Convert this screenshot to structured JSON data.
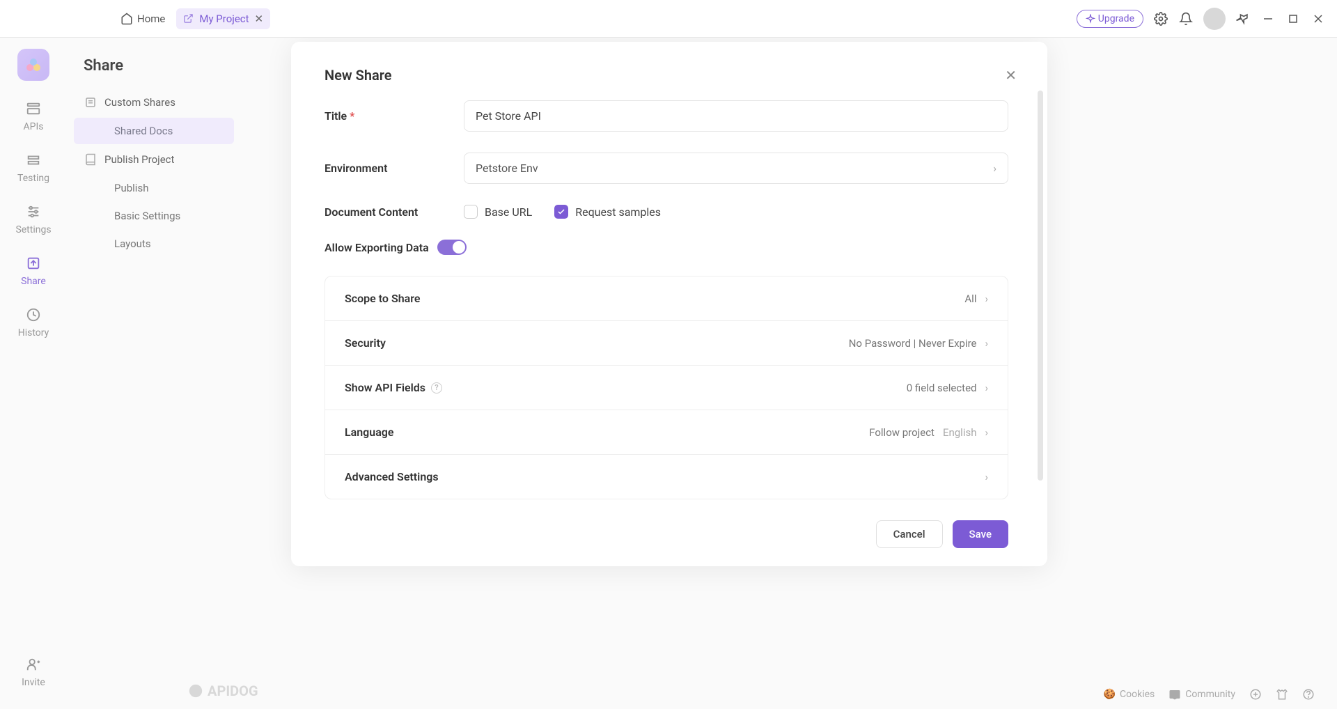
{
  "header": {
    "home_tab": "Home",
    "project_tab": "My Project",
    "upgrade": "Upgrade"
  },
  "rail": {
    "apis": "APIs",
    "testing": "Testing",
    "settings": "Settings",
    "share": "Share",
    "history": "History",
    "invite": "Invite"
  },
  "sidepanel": {
    "title": "Share",
    "custom_shares": "Custom Shares",
    "shared_docs": "Shared Docs",
    "publish_project": "Publish Project",
    "publish": "Publish",
    "basic_settings": "Basic Settings",
    "layouts": "Layouts"
  },
  "modal": {
    "title": "New Share",
    "fields": {
      "title_label": "Title",
      "title_value": "Pet Store API",
      "env_label": "Environment",
      "env_value": "Petstore Env",
      "doc_content_label": "Document Content",
      "base_url": "Base URL",
      "request_samples": "Request samples",
      "export_label": "Allow Exporting Data"
    },
    "settings": {
      "scope_label": "Scope to Share",
      "scope_value": "All",
      "security_label": "Security",
      "security_value": "No Password | Never Expire",
      "api_fields_label": "Show API Fields",
      "api_fields_value": "0 field selected",
      "language_label": "Language",
      "language_value1": "Follow project",
      "language_value2": "English",
      "advanced_label": "Advanced Settings"
    },
    "cancel": "Cancel",
    "save": "Save"
  },
  "footer": {
    "cookies": "Cookies",
    "community": "Community",
    "brand": "APIDOG"
  }
}
